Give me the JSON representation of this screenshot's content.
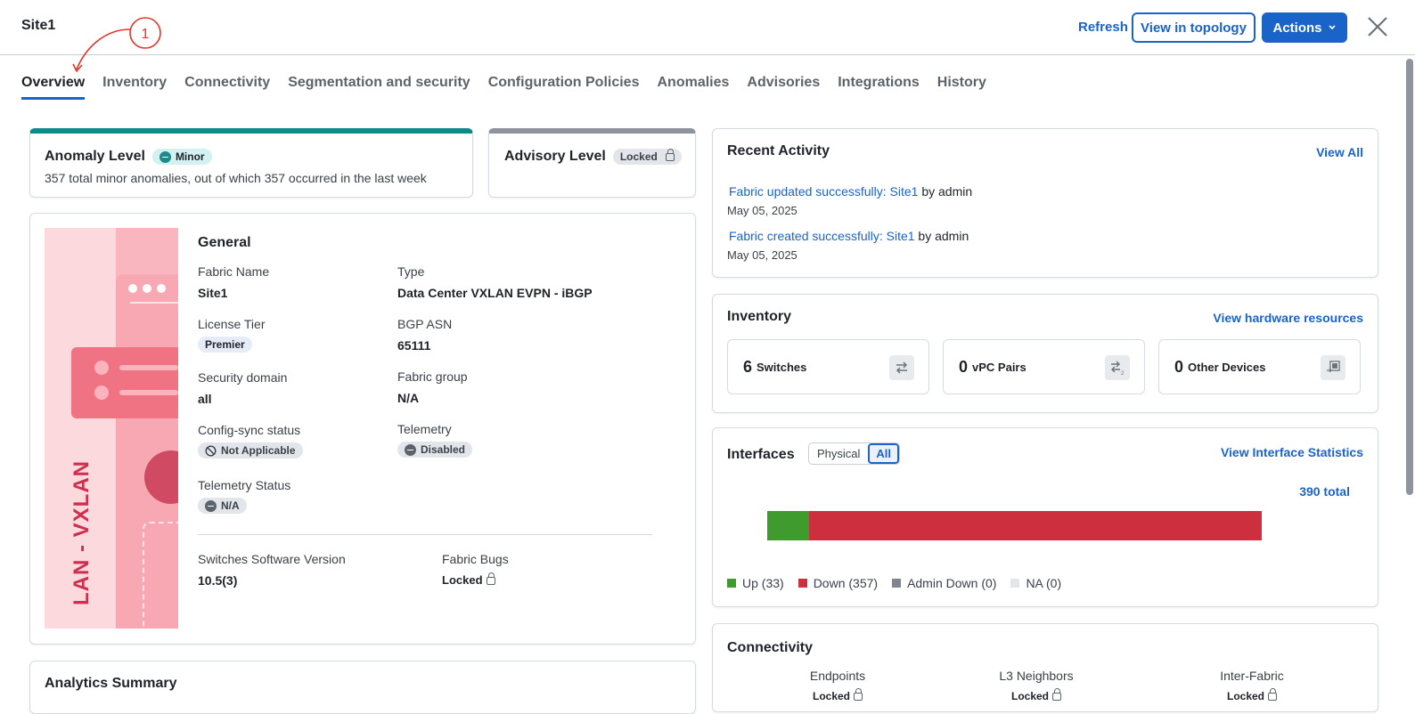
{
  "header": {
    "title": "Site1",
    "refresh_label": "Refresh",
    "topology_label": "View in topology",
    "actions_label": "Actions"
  },
  "annotation": {
    "number": "1"
  },
  "tabs": [
    {
      "label": "Overview",
      "active": true
    },
    {
      "label": "Inventory"
    },
    {
      "label": "Connectivity"
    },
    {
      "label": "Segmentation and security"
    },
    {
      "label": "Configuration Policies"
    },
    {
      "label": "Anomalies"
    },
    {
      "label": "Advisories"
    },
    {
      "label": "Integrations"
    },
    {
      "label": "History"
    }
  ],
  "anomaly": {
    "title": "Anomaly Level",
    "badge": "Minor",
    "description": "357 total minor anomalies, out of which 357 occurred in the last week",
    "accent": "#0f8a8a"
  },
  "advisory": {
    "title": "Advisory Level",
    "badge": "Locked",
    "accent": "#8d949b"
  },
  "general": {
    "banner_text": "LAN - VXLAN",
    "title": "General",
    "fabric_name_label": "Fabric Name",
    "fabric_name": "Site1",
    "type_label": "Type",
    "type": "Data Center VXLAN EVPN - iBGP",
    "license_label": "License Tier",
    "license": "Premier",
    "bgp_label": "BGP ASN",
    "bgp": "65111",
    "security_label": "Security domain",
    "security": "all",
    "fabric_group_label": "Fabric group",
    "fabric_group": "N/A",
    "config_sync_label": "Config-sync status",
    "config_sync": "Not Applicable",
    "telemetry_label": "Telemetry",
    "telemetry": "Disabled",
    "telemetry_status_label": "Telemetry Status",
    "telemetry_status": "N/A",
    "sw_version_label": "Switches Software Version",
    "sw_version": "10.5(3)",
    "bugs_label": "Fabric Bugs",
    "bugs": "Locked"
  },
  "analytics": {
    "title": "Analytics Summary"
  },
  "recent": {
    "title": "Recent Activity",
    "view_all": "View All",
    "items": [
      {
        "link": "Fabric updated successfully: Site1",
        "by": "by admin",
        "date": "May 05, 2025"
      },
      {
        "link": "Fabric created successfully: Site1",
        "by": "by admin",
        "date": "May 05, 2025"
      }
    ]
  },
  "inventory": {
    "title": "Inventory",
    "link": "View hardware resources",
    "boxes": [
      {
        "count": "6",
        "label": "Switches",
        "icon": "switch-icon"
      },
      {
        "count": "0",
        "label": "vPC Pairs",
        "icon": "vpc-pair-icon"
      },
      {
        "count": "0",
        "label": "Other Devices",
        "icon": "other-devices-icon"
      }
    ]
  },
  "interfaces": {
    "title": "Interfaces",
    "toggle_physical": "Physical",
    "toggle_all": "All",
    "link": "View Interface Statistics",
    "total": "390 total",
    "legend": [
      {
        "label": "Up (33)",
        "color": "#3f9b2e",
        "value": 33
      },
      {
        "label": "Down (357)",
        "color": "#cd2f3e",
        "value": 357
      },
      {
        "label": "Admin Down (0)",
        "color": "#7f868d",
        "value": 0
      },
      {
        "label": "NA (0)",
        "color": "#e3e6e9",
        "value": 0
      }
    ]
  },
  "connectivity": {
    "title": "Connectivity",
    "cols": [
      {
        "label": "Endpoints",
        "value": "Locked"
      },
      {
        "label": "L3 Neighbors",
        "value": "Locked"
      },
      {
        "label": "Inter-Fabric",
        "value": "Locked"
      }
    ]
  }
}
